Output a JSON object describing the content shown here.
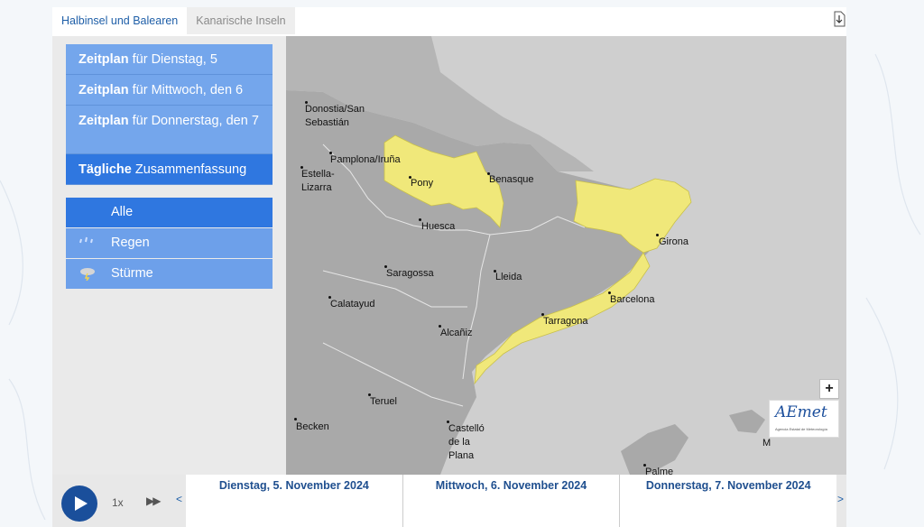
{
  "tabs": [
    {
      "label": "Halbinsel und Balearen",
      "active": true
    },
    {
      "label": "Kanarische Inseln",
      "active": false
    }
  ],
  "download_icon": "download-icon",
  "schedule": [
    {
      "bold": "Zeitplan",
      "rest": " für Dienstag, 5"
    },
    {
      "bold": "Zeitplan",
      "rest": " für Mittwoch, den 6"
    },
    {
      "bold": "Zeitplan",
      "rest": " für Donnerstag, den 7"
    },
    {
      "bold": "Tägliche",
      "rest": " Zusammenfassung"
    }
  ],
  "filters": [
    {
      "label": "Alle",
      "icon": "",
      "active": true
    },
    {
      "label": "Regen",
      "icon": "rain-icon",
      "active": false
    },
    {
      "label": "Stürme",
      "icon": "storm-icon",
      "active": false
    }
  ],
  "cities": [
    "Donostia/San\nSebastián",
    "Pamplona/Iruña",
    "Estella-\nLizarra",
    "Pony",
    "Benasque",
    "Huesca",
    "Girona",
    "Saragossa",
    "Lleida",
    "Calatayud",
    "Barcelona",
    "Alcañiz",
    "Tarragona",
    "Teruel",
    "Becken",
    "Castelló\nde la\nPlana",
    "Palme",
    "M"
  ],
  "zoom": {
    "in": "+",
    "out": "−"
  },
  "logo": {
    "title": "AEmet",
    "subtitle": "Agencia Estatal de Meteorología"
  },
  "playback": {
    "speed": "1x",
    "fast_forward": "▶▶",
    "prev": "<",
    "next": ">"
  },
  "days": [
    "Dienstag, 5. November 2024",
    "Mittwoch, 6. November 2024",
    "Donnerstag, 7. November 2024"
  ],
  "colors": {
    "warning_yellow": "#f0e87a",
    "land_gray": "#a9a9a9",
    "sea_gray": "#cfcfcf",
    "active_blue": "#2f77e0",
    "button_blue": "#74a6ec"
  }
}
